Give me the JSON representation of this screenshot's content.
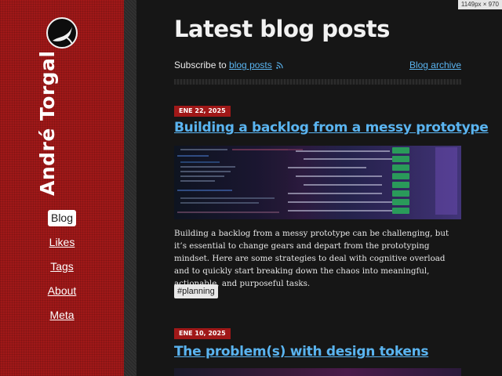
{
  "site": {
    "name": "André Torgal"
  },
  "nav": {
    "items": [
      {
        "label": "Blog",
        "active": true
      },
      {
        "label": "Likes",
        "active": false
      },
      {
        "label": "Tags",
        "active": false
      },
      {
        "label": "About",
        "active": false
      },
      {
        "label": "Meta",
        "active": false
      }
    ]
  },
  "page": {
    "title": "Latest blog posts",
    "subscribe_prefix": "Subscribe to",
    "subscribe_link": "blog posts",
    "archive_link": "Blog archive"
  },
  "posts": [
    {
      "date": "ENE 22, 2025",
      "title": "Building a backlog from a messy prototype",
      "excerpt": "Building a backlog from a messy prototype can be challenging, but it’s essential to change gears and depart from the prototyping mindset. Here are some strategies to deal with cognitive overload and to quickly start breaking down the chaos into meaningful, actionable, and purposeful tasks.",
      "tags": [
        "#planning"
      ]
    },
    {
      "date": "ENE 10, 2025",
      "title": "The problem(s) with design tokens"
    }
  ],
  "viewport_hint": "1149px × 970",
  "icons": {
    "logo": "seagull-logo-icon",
    "rss": "rss-icon"
  },
  "colors": {
    "sidebar": "#a01818",
    "link": "#5ab4f0",
    "badge": "#a01818",
    "background": "#161616"
  }
}
